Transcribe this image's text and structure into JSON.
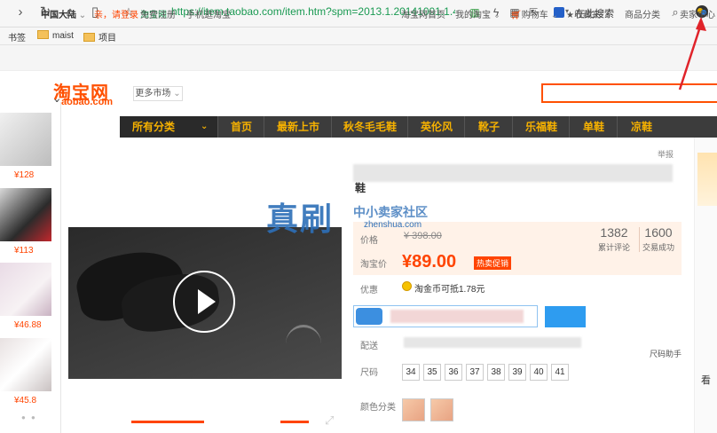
{
  "browser": {
    "site_name": "淘宝网",
    "url": "https://item.taobao.com/item.htm?spm=2013.1.20141001.1.41",
    "search_engine_text": "在此搜索"
  },
  "bookmarks": [
    "书签",
    "maist",
    "项目"
  ],
  "site_nav": {
    "region": "中国大陆",
    "login": "亲，请登录",
    "register": "免费注册",
    "mobile": "手机逛淘宝",
    "home": "淘宝网首页",
    "my_taobao": "我的淘宝",
    "cart": "购物车",
    "favorites": "收藏夹",
    "categories": "商品分类",
    "seller_center": "卖家中心"
  },
  "header": {
    "logo": "淘宝网",
    "logo_sub": "aobao.com",
    "more_markets": "更多市场"
  },
  "categories": {
    "all": "所有分类",
    "items": [
      "首页",
      "最新上市",
      "秋冬毛毛鞋",
      "英伦风",
      "靴子",
      "乐福鞋",
      "单鞋",
      "凉鞋"
    ]
  },
  "sidebar": {
    "prices": [
      "¥128",
      "¥113",
      "¥46.88",
      "¥45.8"
    ]
  },
  "product": {
    "report": "举报",
    "title_fragment": "鞋",
    "community": "中小卖家社区",
    "labels": {
      "price": "价格",
      "taobao_price": "淘宝价",
      "promo": "优惠",
      "delivery": "配送",
      "size": "尺码",
      "color": "颜色分类"
    },
    "old_price": "¥ 398.00",
    "price": "¥89.00",
    "hot_badge": "热卖促销",
    "reviews_count": "1382",
    "reviews_label": "累计评论",
    "sales_count": "1600",
    "sales_label": "交易成功",
    "coin_text": "淘金币可抵1.78元",
    "scan_text": "尺码助手",
    "sizes": [
      "34",
      "35",
      "36",
      "37",
      "38",
      "39",
      "40",
      "41"
    ]
  },
  "watermark": {
    "main": "真刷",
    "sub": "zhenshua.com"
  },
  "right_strip": {
    "text": "看"
  }
}
